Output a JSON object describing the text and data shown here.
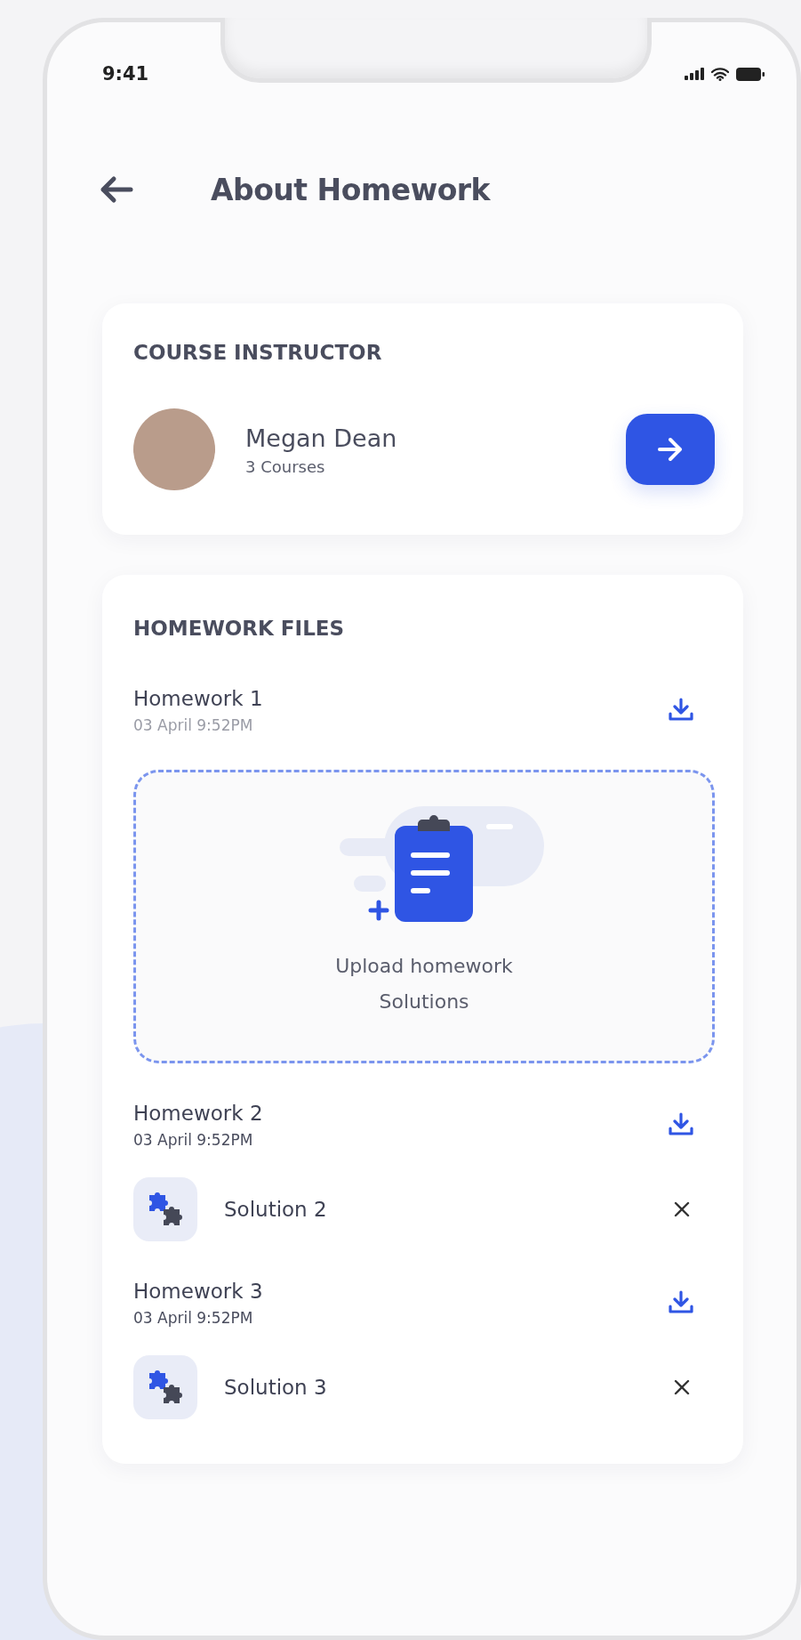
{
  "status_bar": {
    "time": "9:41"
  },
  "header": {
    "title": "About Homework"
  },
  "instructor_card": {
    "heading": "COURSE INSTRUCTOR",
    "name": "Megan Dean",
    "courses": "3 Courses"
  },
  "files_card": {
    "heading": "HOMEWORK FILES",
    "items": [
      {
        "kind": "upload",
        "title": "Homework 1",
        "date": "03 April 9:52PM",
        "upload_text": "Upload homework Solutions"
      },
      {
        "kind": "solution",
        "title": "Homework 2",
        "date": "03 April 9:52PM",
        "solution": "Solution 2"
      },
      {
        "kind": "solution",
        "title": "Homework 3",
        "date": "03 April 9:52PM",
        "solution": "Solution 3"
      }
    ]
  }
}
